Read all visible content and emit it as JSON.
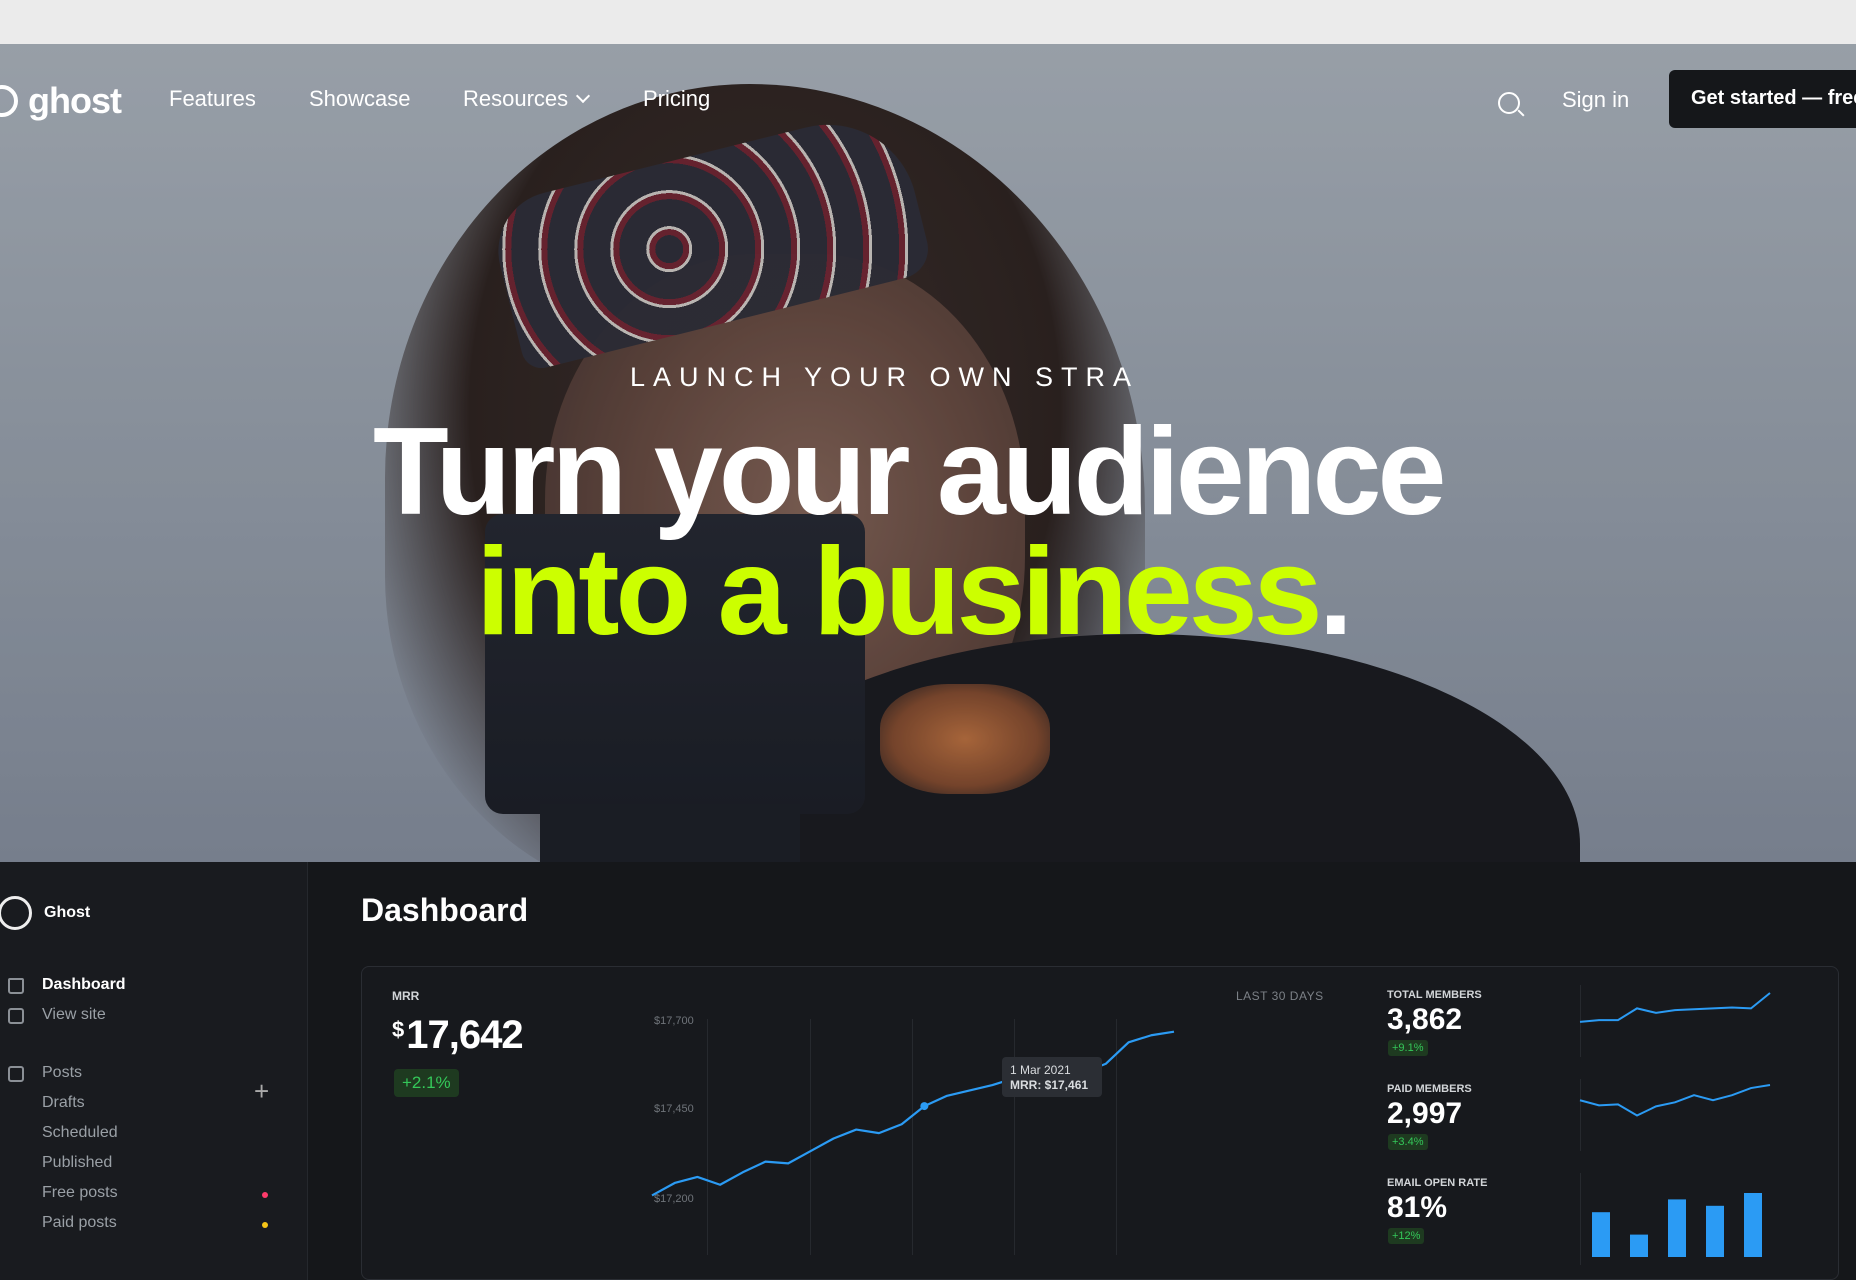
{
  "nav": {
    "brand": "ghost",
    "links": [
      "Features",
      "Showcase",
      "Resources",
      "Pricing"
    ],
    "signin": "Sign in",
    "cta": "Get started — free"
  },
  "hero": {
    "eyebrow": "LAUNCH YOUR OWN STRA",
    "headline_line1": "Turn your audience",
    "headline_line2": "into a business",
    "headline_dot": ".",
    "accent_color": "#ccff00"
  },
  "sidebar": {
    "brand": "Ghost",
    "items": [
      {
        "label": "Dashboard",
        "icon": "home-icon",
        "active": true
      },
      {
        "label": "View site",
        "icon": "layout-icon"
      },
      {
        "label": "Posts",
        "icon": "edit-icon"
      },
      {
        "label": "Drafts"
      },
      {
        "label": "Scheduled"
      },
      {
        "label": "Published"
      },
      {
        "label": "Free posts",
        "dot_color": "#ff3b6b"
      },
      {
        "label": "Paid posts",
        "dot_color": "#f5c518"
      }
    ]
  },
  "dashboard": {
    "title": "Dashboard",
    "mrr_label": "MRR",
    "mrr_currency": "$",
    "mrr_value": "17,642",
    "mrr_change": "+2.1%",
    "range_label": "LAST 30 DAYS",
    "tooltip_date": "1 Mar 2021",
    "tooltip_value": "MRR: $17,461",
    "kpis": [
      {
        "label": "TOTAL MEMBERS",
        "value": "3,862",
        "change": "+9.1%"
      },
      {
        "label": "PAID MEMBERS",
        "value": "2,997",
        "change": "+3.4%"
      },
      {
        "label": "EMAIL OPEN RATE",
        "value": "81%",
        "change": "+12%"
      }
    ]
  },
  "chart_data": [
    {
      "type": "line",
      "title": "MRR",
      "ylim": [
        17200,
        17700
      ],
      "yticks": [
        "$17,700",
        "$17,450",
        "$17,200"
      ],
      "values": [
        17210,
        17245,
        17262,
        17240,
        17275,
        17305,
        17300,
        17335,
        17370,
        17395,
        17385,
        17410,
        17461,
        17490,
        17505,
        17520,
        17540,
        17530,
        17545,
        17555,
        17580,
        17640,
        17660,
        17670
      ],
      "highlight_index": 12,
      "color": "#2b9bf4"
    },
    {
      "type": "line",
      "title": "Total members",
      "values": [
        30,
        32,
        32,
        45,
        40,
        43,
        44,
        45,
        46,
        45,
        62
      ],
      "color": "#2b9bf4"
    },
    {
      "type": "line",
      "title": "Paid members",
      "values": [
        40,
        35,
        36,
        25,
        34,
        38,
        45,
        40,
        45,
        52,
        55
      ],
      "color": "#2b9bf4"
    },
    {
      "type": "bar",
      "title": "Email open rate",
      "values": [
        70,
        35,
        90,
        80,
        100
      ],
      "color": "#2b9bf4"
    }
  ]
}
